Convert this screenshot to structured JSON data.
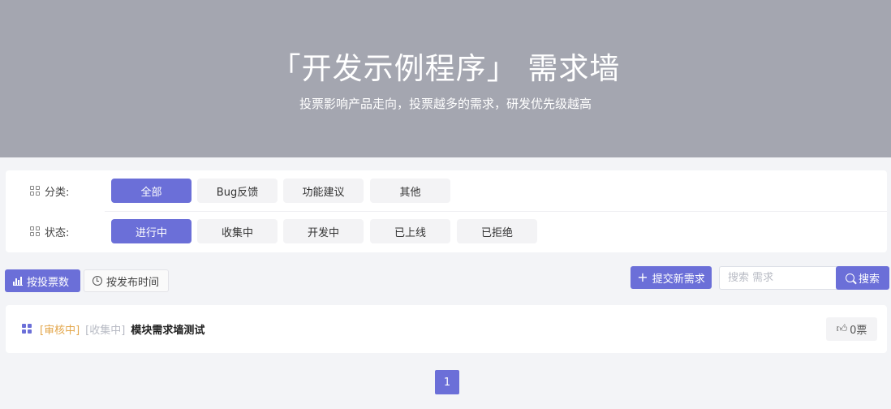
{
  "hero": {
    "title": "「开发示例程序」 需求墙",
    "subtitle": "投票影响产品走向，投票越多的需求，研发优先级越高",
    "background": "#a4a6b0"
  },
  "filters": {
    "category": {
      "label": "分类:",
      "icon": "grid-icon",
      "options": [
        "全部",
        "Bug反馈",
        "功能建议",
        "其他"
      ],
      "selected": "全部"
    },
    "status": {
      "label": "状态:",
      "icon": "grid-icon",
      "options": [
        "进行中",
        "收集中",
        "开发中",
        "已上线",
        "已拒绝"
      ],
      "selected": "进行中"
    }
  },
  "toolbar": {
    "sort_votes": "按投票数",
    "sort_time": "按发布时间",
    "submit": "提交新需求",
    "search_placeholder": "搜索 需求",
    "search_button": "搜索"
  },
  "items": [
    {
      "status_tag": "[审核中]",
      "stage_tag": "[收集中]",
      "title": "模块需求墙测试",
      "votes": "0票"
    }
  ],
  "pagination": {
    "current": "1"
  },
  "colors": {
    "accent": "#6b6fd8",
    "review_tag": "#e3a64a",
    "collect_tag": "#b8bbc4"
  }
}
